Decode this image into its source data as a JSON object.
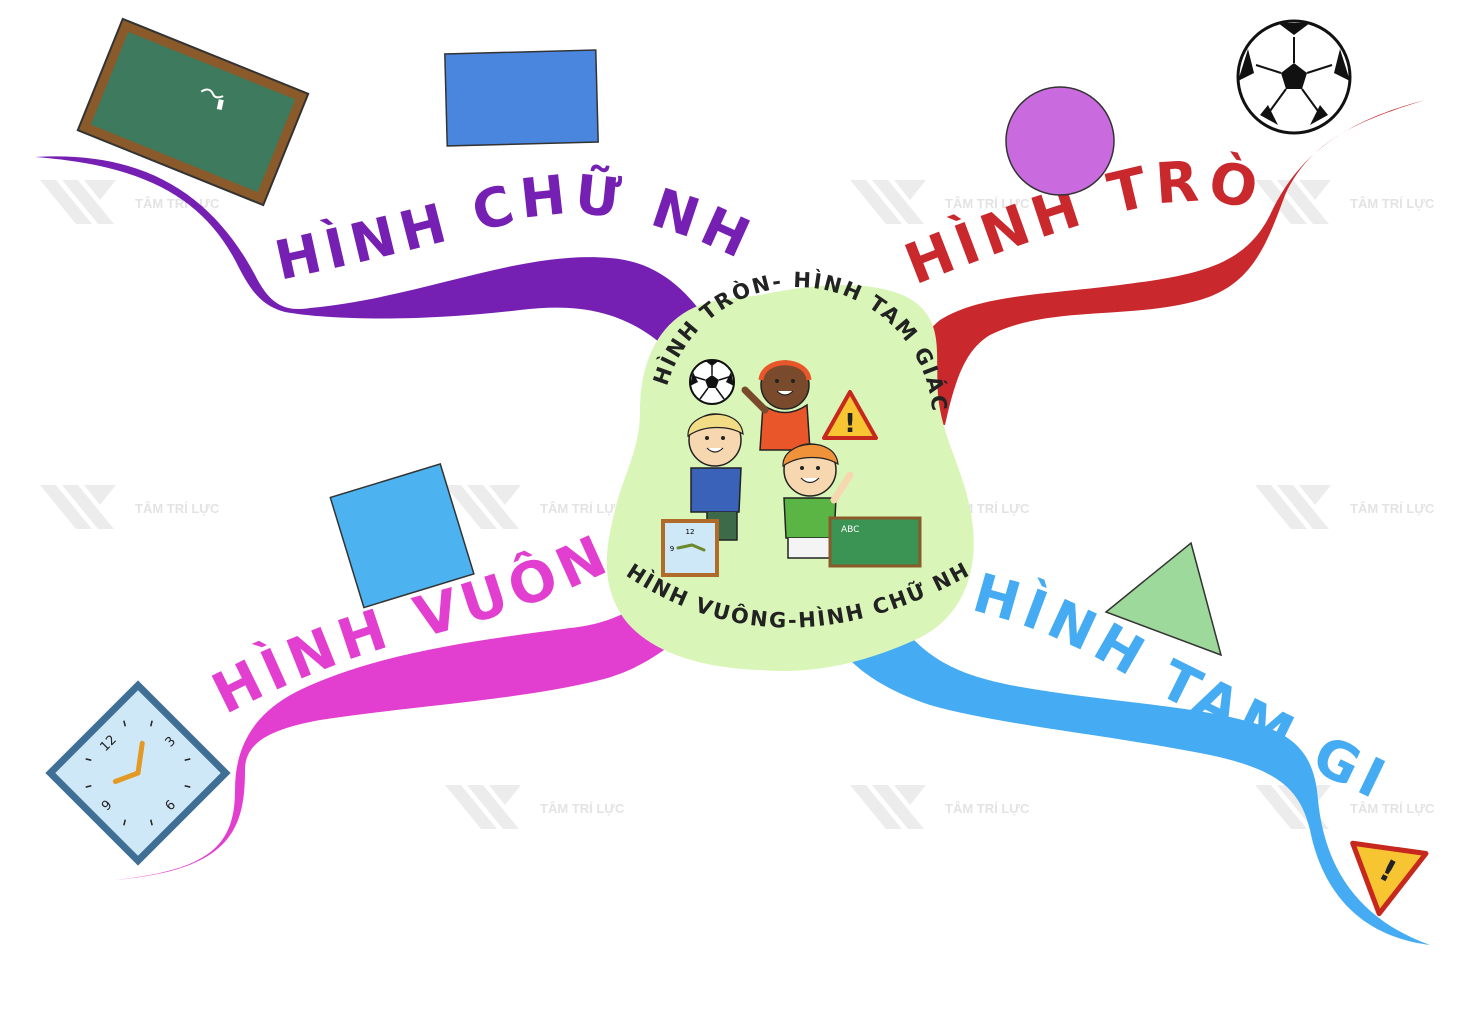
{
  "center": {
    "top_text": "HÌNH TRÒN- HÌNH TAM GIÁC",
    "bottom_text": "HÌNH VUÔNG-HÌNH CHỮ NHẬT",
    "bubble_color": "#d9f5b8"
  },
  "branches": [
    {
      "id": "rectangle",
      "label": "HÌNH CHỮ NHẬT",
      "color": "#7620b3"
    },
    {
      "id": "circle",
      "label": "HÌNH TRÒN",
      "color": "#c9282d"
    },
    {
      "id": "square",
      "label": "HÌNH VUÔNG",
      "color": "#e23fd0"
    },
    {
      "id": "triangle",
      "label": "HÌNH TAM GIÁC",
      "color": "#45abf2"
    }
  ],
  "illustrations": {
    "chalkboard": {
      "text": "ABC"
    },
    "clock": {
      "numbers": [
        "12",
        "3",
        "6",
        "9"
      ]
    },
    "warning_sign": {
      "symbol": "!"
    },
    "shapes": {
      "rectangle_color": "#4a86de",
      "circle_color": "#c96ade",
      "square_color": "#4cb3f0",
      "triangle_color": "#9dd99a"
    }
  },
  "watermark": {
    "text": "TÂM TRÍ LỰC"
  }
}
